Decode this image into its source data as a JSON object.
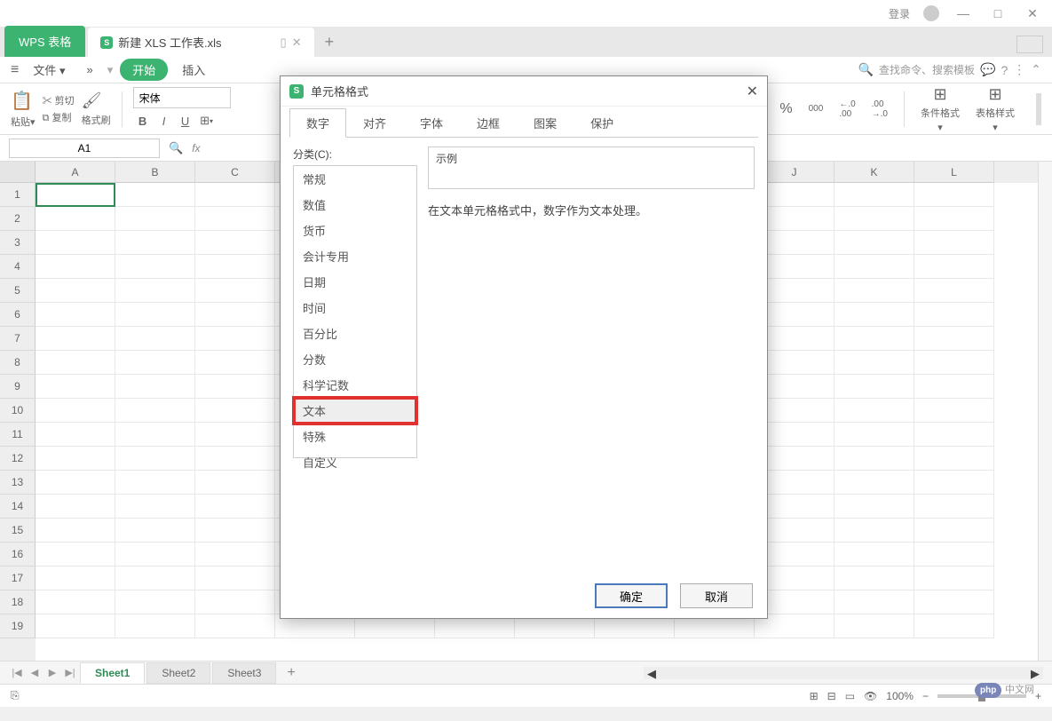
{
  "titlebar": {
    "login": "登录"
  },
  "tabs": {
    "app": "WPS 表格",
    "file": "新建 XLS 工作表.xls",
    "add": "+"
  },
  "ribbon": {
    "file": "文件",
    "more": "»",
    "start": "开始",
    "insert": "插入",
    "search_placeholder": "查找命令、搜索模板"
  },
  "toolbar": {
    "cut": "剪切",
    "paste": "粘贴",
    "copy": "复制",
    "formatpaint": "格式刷",
    "font": "宋体",
    "bold": "B",
    "italic": "I",
    "underline": "U",
    "percent": "%",
    "comma": "000",
    "dec_inc": ".00",
    "dec_dec": ".00",
    "cond_format": "条件格式",
    "table_style": "表格样式"
  },
  "formula": {
    "cellref": "A1",
    "fx": "fx"
  },
  "grid": {
    "cols": [
      "A",
      "B",
      "C",
      "",
      "",
      "",
      "",
      "",
      "",
      "J",
      "K",
      "L"
    ],
    "rows": [
      "1",
      "2",
      "3",
      "4",
      "5",
      "6",
      "7",
      "8",
      "9",
      "10",
      "11",
      "12",
      "13",
      "14",
      "15",
      "16",
      "17",
      "18",
      "19"
    ]
  },
  "sheets": {
    "s1": "Sheet1",
    "s2": "Sheet2",
    "s3": "Sheet3",
    "add": "+"
  },
  "status": {
    "zoom": "100%",
    "watermark_brand": "php",
    "watermark_text": "中文网"
  },
  "dialog": {
    "title": "单元格格式",
    "tabs": {
      "number": "数字",
      "align": "对齐",
      "font": "字体",
      "border": "边框",
      "pattern": "图案",
      "protect": "保护"
    },
    "category_label": "分类(C):",
    "categories": {
      "general": "常规",
      "number": "数值",
      "currency": "货币",
      "accounting": "会计专用",
      "date": "日期",
      "time": "时间",
      "percent": "百分比",
      "fraction": "分数",
      "scientific": "科学记数",
      "text": "文本",
      "special": "特殊",
      "custom": "自定义"
    },
    "example_label": "示例",
    "description": "在文本单元格格式中，数字作为文本处理。",
    "ok": "确定",
    "cancel": "取消"
  }
}
